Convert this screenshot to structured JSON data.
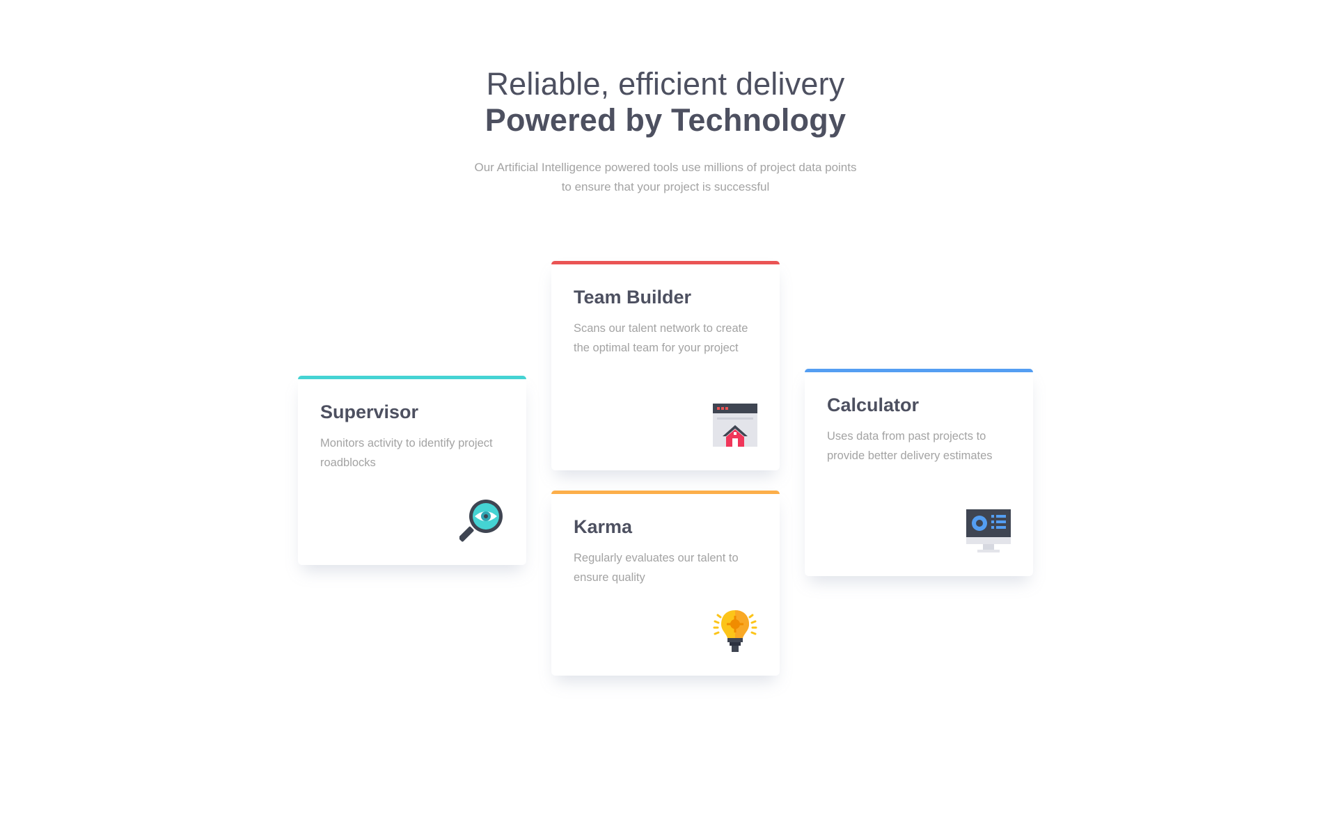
{
  "header": {
    "title_light": "Reliable, efficient delivery",
    "title_bold": "Powered by Technology",
    "subtitle": "Our Artificial Intelligence powered tools use millions of project data points to ensure that your project is successful"
  },
  "colors": {
    "supervisor": "#45d3d3",
    "team_builder": "#ea5454",
    "karma": "#fcae4a",
    "calculator": "#549ef2"
  },
  "cards": {
    "supervisor": {
      "title": "Supervisor",
      "description": "Monitors activity to identify project roadblocks",
      "icon": "supervisor-magnifier-eye-icon"
    },
    "team_builder": {
      "title": "Team Builder",
      "description": "Scans our talent network to create the optimal team for your project",
      "icon": "team-builder-house-window-icon"
    },
    "karma": {
      "title": "Karma",
      "description": "Regularly evaluates our talent to ensure quality",
      "icon": "karma-lightbulb-icon"
    },
    "calculator": {
      "title": "Calculator",
      "description": "Uses data from past projects to provide better delivery estimates",
      "icon": "calculator-monitor-icon"
    }
  }
}
